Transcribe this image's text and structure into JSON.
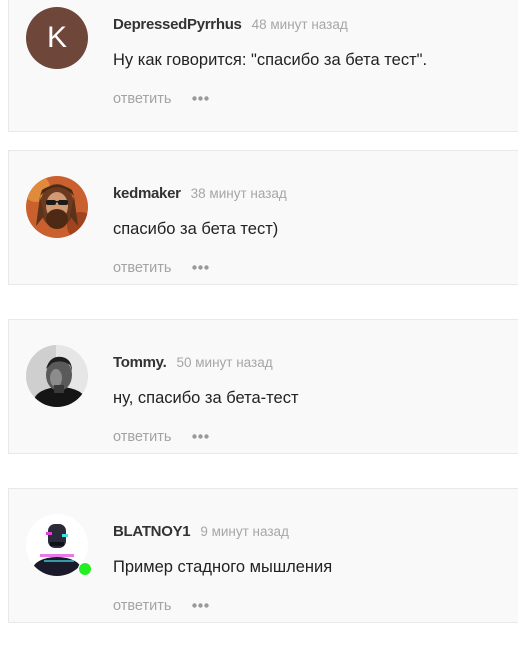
{
  "comments": [
    {
      "avatar_letter": "K",
      "author": "DepressedPyrrhus",
      "time": "48 минут назад",
      "text": "Ну как говорится: \"спасибо за бета тест\".",
      "reply_label": "ответить",
      "more_icon": "ellipsis-icon"
    },
    {
      "author": "kedmaker",
      "time": "38 минут назад",
      "text": "спасибо за бета тест)",
      "reply_label": "ответить",
      "more_icon": "ellipsis-icon"
    },
    {
      "author": "Tommy.",
      "time": "50 минут назад",
      "text": "ну, спасибо за бета-тест",
      "reply_label": "ответить",
      "more_icon": "ellipsis-icon"
    },
    {
      "author": "BLATNOY1",
      "time": "9 минут назад",
      "text": "Пример стадного мышления",
      "reply_label": "ответить",
      "more_icon": "ellipsis-icon",
      "online": true
    }
  ],
  "colors": {
    "author": "#333333",
    "time": "#a6a6a6",
    "reply": "#a3a3a3",
    "online": "#22ee22",
    "letter_avatar_bg": "#6e463a"
  }
}
